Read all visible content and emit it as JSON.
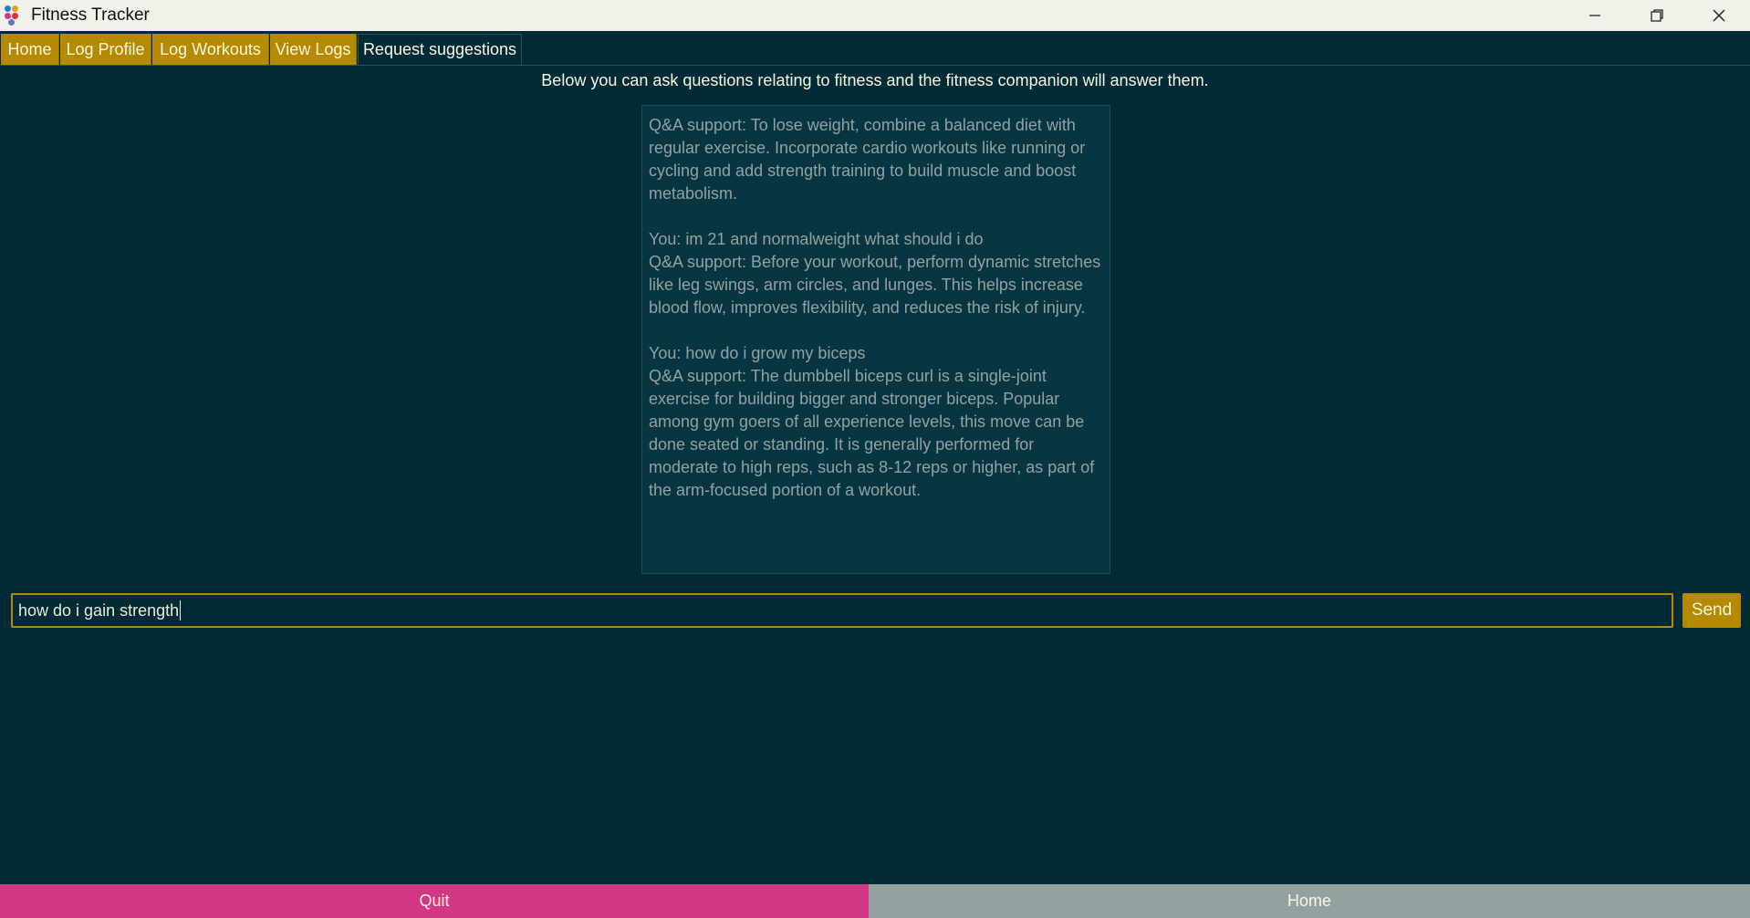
{
  "window": {
    "title": "Fitness Tracker"
  },
  "tabs": [
    {
      "label": "Home"
    },
    {
      "label": "Log Profile"
    },
    {
      "label": "Log Workouts"
    },
    {
      "label": "View Logs"
    },
    {
      "label": "Request suggestions",
      "active": true
    }
  ],
  "main": {
    "intro": "Below you can ask questions relating to fitness and the fitness companion will answer them.",
    "chat_log": "Q&A support: To lose weight, combine a balanced diet with regular exercise. Incorporate cardio workouts like running or cycling and add strength training to build muscle and boost metabolism.\n\nYou: im 21 and normalweight what should i do\nQ&A support: Before your workout, perform dynamic stretches like leg swings, arm circles, and lunges. This helps increase blood flow, improves flexibility, and reduces the risk of injury.\n\nYou: how do i grow my biceps\nQ&A support: The dumbbell biceps curl is a single-joint exercise for building bigger and stronger biceps. Popular among gym goers of all experience levels, this move can be done seated or standing. It is generally performed for moderate to high reps, such as 8-12 reps or higher, as part of the arm-focused portion of a workout.",
    "input_value": "how do i gain strength",
    "send_label": "Send"
  },
  "footer": {
    "quit_label": "Quit",
    "home_label": "Home"
  },
  "colors": {
    "background": "#002b36",
    "tab_accent": "#b58900",
    "quit": "#d33682",
    "home": "#93a1a1"
  }
}
